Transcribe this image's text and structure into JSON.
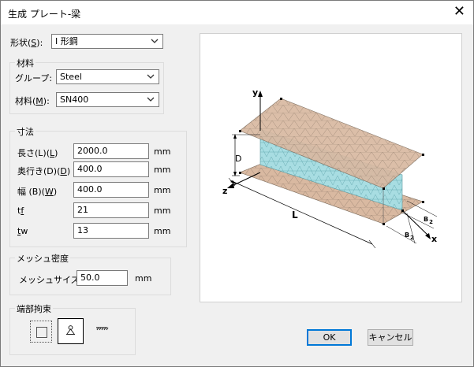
{
  "window": {
    "title": "生成 プレート-梁"
  },
  "shape": {
    "label": "形状(",
    "accel": "S",
    "label_end": "):",
    "value": "I 形鋼"
  },
  "material": {
    "group_title": "材料",
    "group_label": "グループ:",
    "group_value": "Steel",
    "material_label": "材料(",
    "material_accel": "M",
    "material_label_end": "):",
    "material_value": "SN400"
  },
  "dimensions": {
    "title": "寸法",
    "rows": [
      {
        "label": "長さ(L)",
        "accel": "L",
        "value": "2000.0",
        "unit": "mm"
      },
      {
        "label": "奥行き(D)",
        "accel": "D",
        "value": "400.0",
        "unit": "mm"
      },
      {
        "label": "幅 (B)",
        "accel": "W",
        "value": "400.0",
        "unit": "mm"
      },
      {
        "label": "t",
        "accel": "f",
        "value": "21",
        "unit": "mm"
      },
      {
        "label": "",
        "accel": "t",
        "suffix": "w",
        "value": "13",
        "unit": "mm"
      }
    ]
  },
  "mesh": {
    "title": "メッシュ密度",
    "label": "メッシュサイズ",
    "value": "50.0",
    "unit": "mm"
  },
  "end_restraint": {
    "title": "端部拘束"
  },
  "diagram": {
    "y": "y",
    "z": "z",
    "x": "x",
    "D": "D",
    "L": "L",
    "B": "B",
    "two": "2"
  },
  "buttons": {
    "ok": "OK",
    "cancel": "キャンセル"
  },
  "colors": {
    "flange": "#d9b9a1",
    "web": "#a8dde2",
    "mesh": "#8f7a6a"
  }
}
